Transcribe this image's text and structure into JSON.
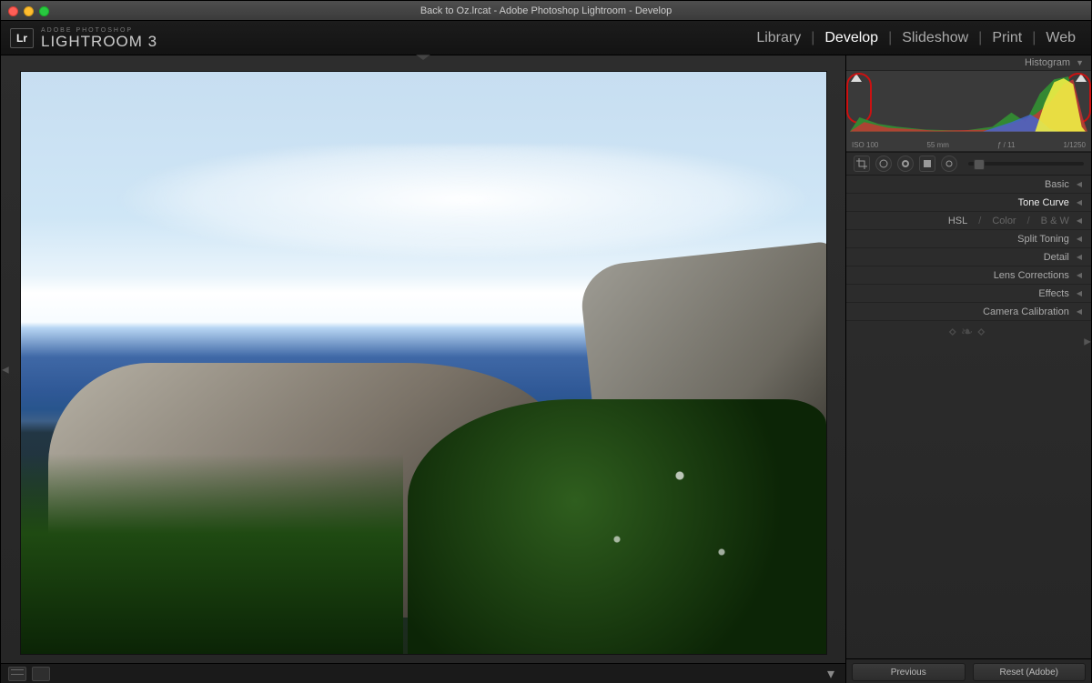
{
  "titlebar": {
    "title": "Back to Oz.lrcat - Adobe Photoshop Lightroom - Develop"
  },
  "branding": {
    "logo": "Lr",
    "small": "ADOBE PHOTOSHOP",
    "big": "LIGHTROOM 3"
  },
  "modules": {
    "items": [
      "Library",
      "Develop",
      "Slideshow",
      "Print",
      "Web"
    ],
    "active": "Develop"
  },
  "rightPanel": {
    "header": "Histogram",
    "histoMeta": {
      "iso": "ISO 100",
      "focal": "55 mm",
      "aperture": "ƒ / 11",
      "shutter": "1/1250"
    },
    "sections": [
      {
        "label": "Basic",
        "active": false
      },
      {
        "label": "Tone Curve",
        "active": true
      },
      {
        "label": "HSL / Color / B & W",
        "active": false,
        "compound": true,
        "parts": [
          "HSL",
          "Color",
          "B & W"
        ]
      },
      {
        "label": "Split Toning",
        "active": false
      },
      {
        "label": "Detail",
        "active": false
      },
      {
        "label": "Lens Corrections",
        "active": false
      },
      {
        "label": "Effects",
        "active": false
      },
      {
        "label": "Camera Calibration",
        "active": false
      }
    ],
    "footer": {
      "prev": "Previous",
      "reset": "Reset (Adobe)"
    }
  }
}
